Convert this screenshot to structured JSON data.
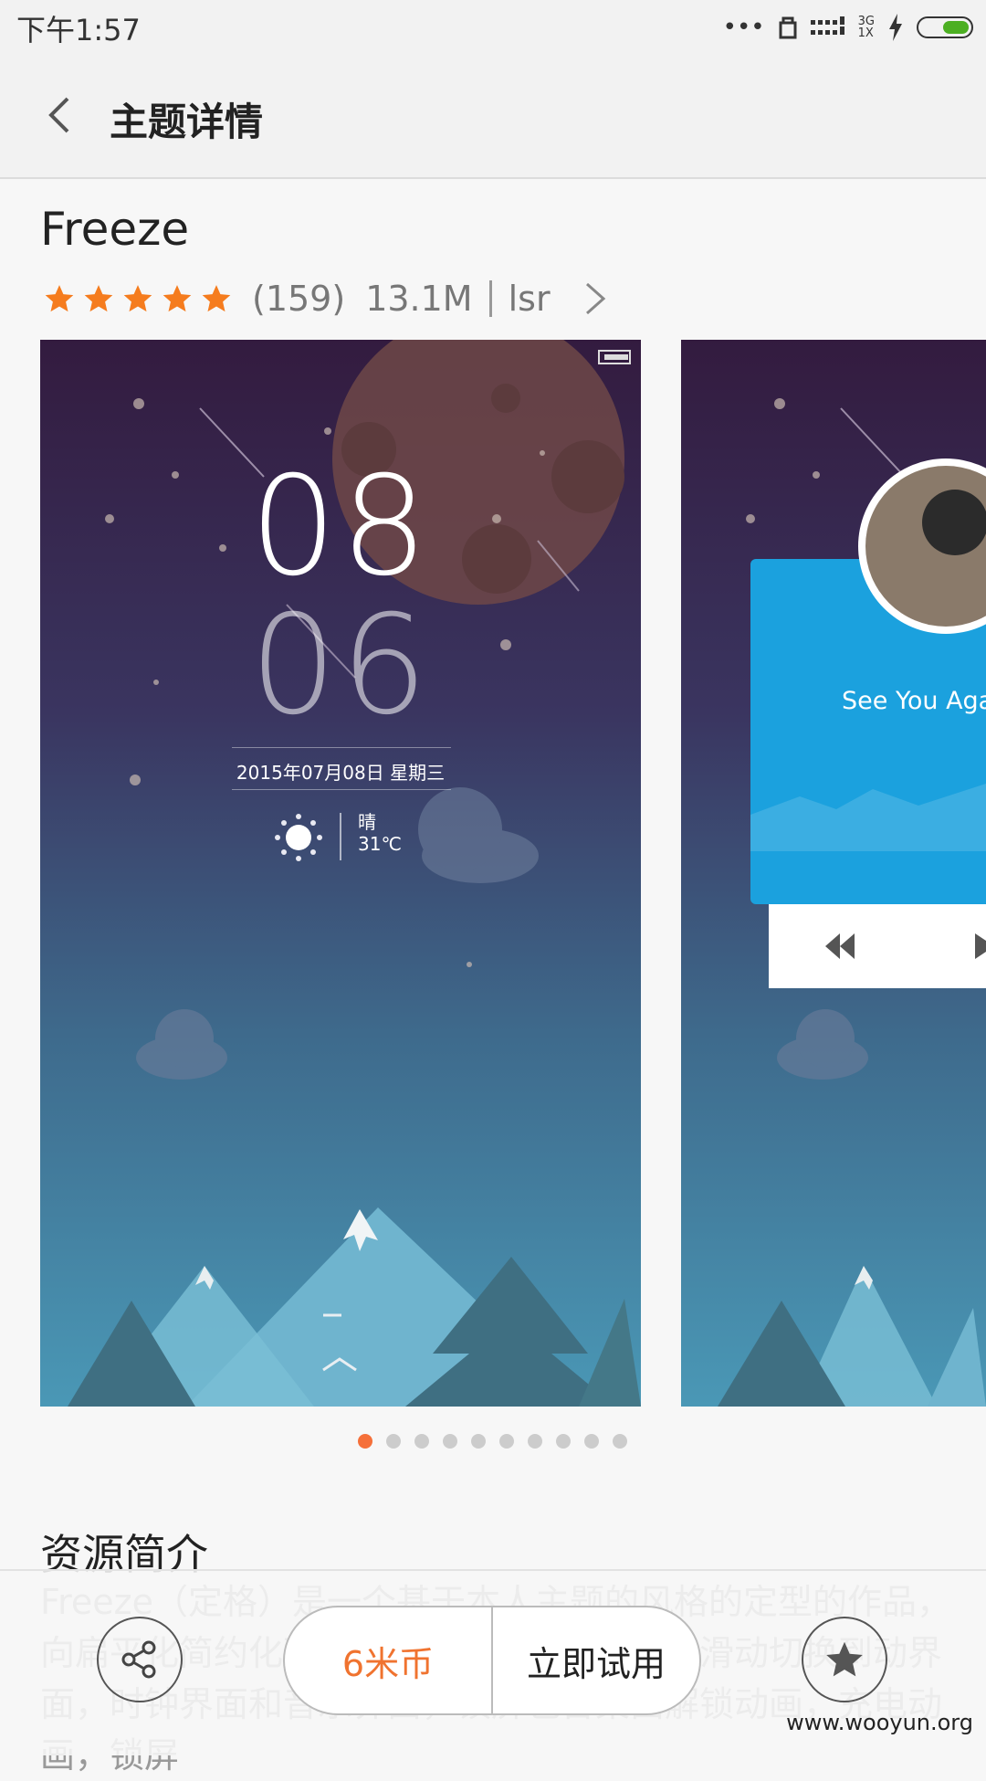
{
  "status_bar": {
    "time": "下午1:57",
    "network": [
      "3G",
      "1X"
    ]
  },
  "header": {
    "title": "主题详情"
  },
  "theme": {
    "name": "Freeze",
    "rating_stars": 5,
    "review_count": "(159)",
    "size": "13.1M",
    "author": "lsr"
  },
  "preview1": {
    "hour": "08",
    "minute": "06",
    "date": "2015年07月08日  星期三",
    "weather_text": "晴",
    "temperature": "31℃"
  },
  "preview2": {
    "song_title": "See You Agai"
  },
  "pager": {
    "count": 10,
    "active_index": 0
  },
  "description": {
    "heading": "资源简介",
    "text": "Freeze（定格）是一个基于本人主题的风格的定型的作品，向扁平化简约化致敬。锁屏分为三屏，可以滑动切换到动界面，时钟界面和音乐界面，锁屏包含桌面解锁动画，充电动画，锁屏"
  },
  "actions": {
    "price": "6米币",
    "try": "立即试用"
  },
  "watermark": "www.wooyun.org",
  "colors": {
    "accent": "#f5703a",
    "star": "#f57c1e",
    "price": "#f0732f"
  },
  "icons": [
    "back-arrow-icon",
    "chevron-right-icon",
    "share-icon",
    "star-icon",
    "battery-icon",
    "signal-icon"
  ]
}
